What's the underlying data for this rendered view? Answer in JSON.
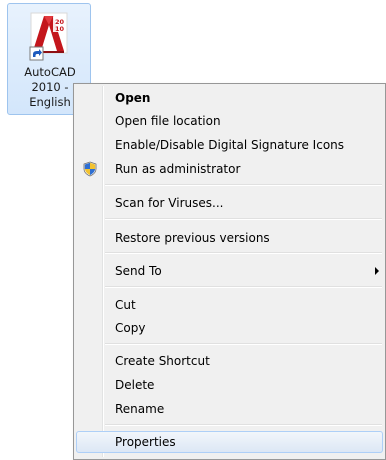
{
  "desktop_icon": {
    "label_lines": [
      "AutoCAD",
      "2010 -",
      "English"
    ],
    "badge_top": "20",
    "badge_bottom": "10"
  },
  "context_menu": {
    "items": [
      {
        "label": "Open"
      },
      {
        "label": "Open file location"
      },
      {
        "label": "Enable/Disable Digital Signature Icons"
      },
      {
        "label": "Run as administrator",
        "icon": "uac-shield-icon"
      },
      {
        "label": "Scan for Viruses..."
      },
      {
        "label": "Restore previous versions"
      },
      {
        "label": "Send To",
        "icon": "submenu-arrow-icon"
      },
      {
        "label": "Cut"
      },
      {
        "label": "Copy"
      },
      {
        "label": "Create Shortcut"
      },
      {
        "label": "Delete"
      },
      {
        "label": "Rename"
      },
      {
        "label": "Properties"
      }
    ]
  },
  "colors": {
    "menu_background": "#f0f0f0",
    "menu_border": "#979797",
    "selection_fill": "#d3e6fb",
    "autocad_red": "#c4161c"
  }
}
